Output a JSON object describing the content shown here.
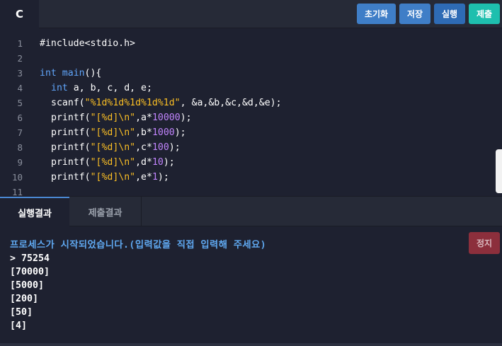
{
  "editor": {
    "language_tab": "C",
    "line_numbers": [
      "1",
      "2",
      "3",
      "4",
      "5",
      "6",
      "7",
      "8",
      "9",
      "10",
      "11"
    ],
    "code": {
      "l1": "#include<stdio.h>",
      "l3_kw": "int",
      "l3_fn": "main",
      "l3_rest": "(){",
      "l4_kw": "int",
      "l4_rest": " a, b, c, d, e;",
      "l5_pre": "scanf(",
      "l5_str": "\"%1d%1d%1d%1d%1d\"",
      "l5_rest": ", &a,&b,&c,&d,&e);",
      "l6": {
        "pre": "printf(",
        "str": "\"[%d]\\n\"",
        "mid": ",a*",
        "num": "10000",
        "end": ");"
      },
      "l7": {
        "pre": "printf(",
        "str": "\"[%d]\\n\"",
        "mid": ",b*",
        "num": "1000",
        "end": ");"
      },
      "l8": {
        "pre": "printf(",
        "str": "\"[%d]\\n\"",
        "mid": ",c*",
        "num": "100",
        "end": ");"
      },
      "l9": {
        "pre": "printf(",
        "str": "\"[%d]\\n\"",
        "mid": ",d*",
        "num": "10",
        "end": ");"
      },
      "l10": {
        "pre": "printf(",
        "str": "\"[%d]\\n\"",
        "mid": ",e*",
        "num": "1",
        "end": ");"
      }
    }
  },
  "toolbar": {
    "reset_label": "초기화",
    "save_label": "저장",
    "run_label": "실행",
    "submit_label": "제출"
  },
  "result_tabs": {
    "run_result": "실행결과",
    "submit_result": "제출결과"
  },
  "console": {
    "stop_label": "정지",
    "info": "프로세스가 시작되었습니다.(입력값을 직접 입력해 주세요)",
    "lines": [
      "> 75254",
      "[70000]",
      "[5000]",
      "[200]",
      "[50]",
      "[4]"
    ]
  },
  "colors": {
    "background": "#1e2130",
    "keyword": "#60a5fa",
    "string": "#fbbf24",
    "number": "#c084fc",
    "submit_button": "#1ebfae",
    "stop_button": "#8c2f3c"
  }
}
